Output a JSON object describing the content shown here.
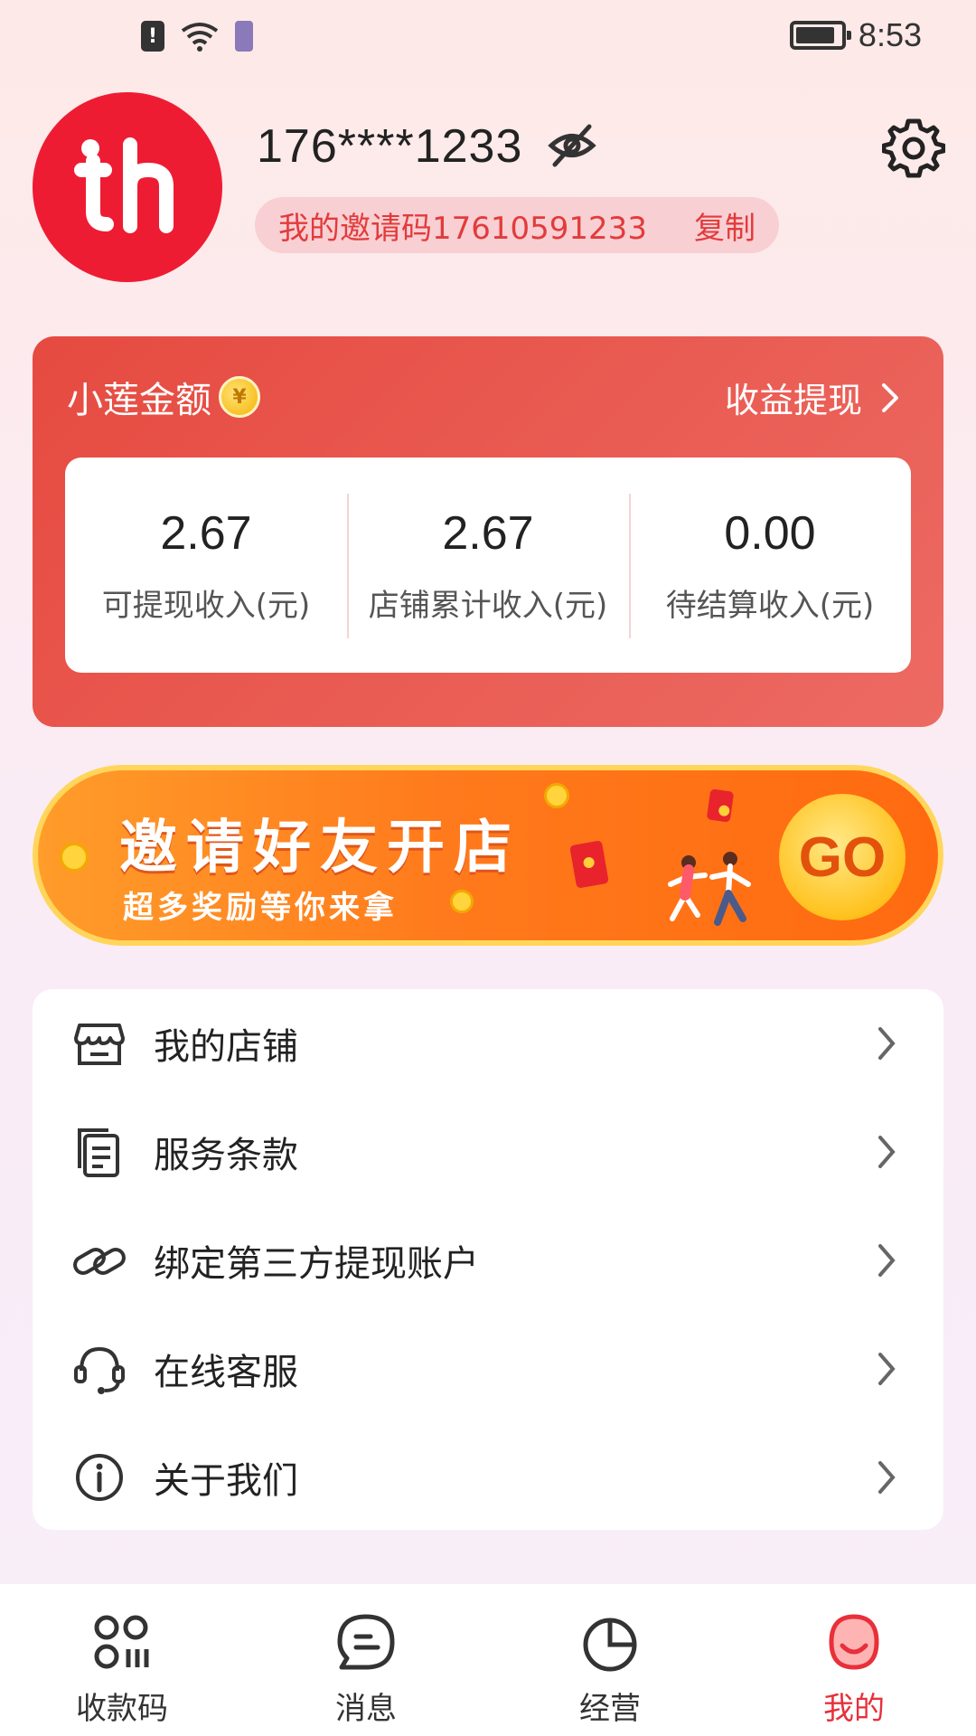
{
  "status_bar": {
    "time": "8:53"
  },
  "profile": {
    "phone": "176****1233",
    "invite_code_text": "我的邀请码17610591233",
    "copy_label": "复制"
  },
  "balance": {
    "title": "小莲金额",
    "withdraw_label": "收益提现",
    "stats": [
      {
        "value": "2.67",
        "label": "可提现收入(元)"
      },
      {
        "value": "2.67",
        "label": "店铺累计收入(元)"
      },
      {
        "value": "0.00",
        "label": "待结算收入(元)"
      }
    ]
  },
  "banner": {
    "title": "邀请好友开店",
    "subtitle": "超多奖励等你来拿",
    "button": "GO"
  },
  "menu": {
    "items": [
      {
        "label": "我的店铺",
        "icon": "store-icon"
      },
      {
        "label": "服务条款",
        "icon": "document-icon"
      },
      {
        "label": "绑定第三方提现账户",
        "icon": "link-icon"
      },
      {
        "label": "在线客服",
        "icon": "headset-icon"
      },
      {
        "label": "关于我们",
        "icon": "info-icon"
      }
    ]
  },
  "tabs": [
    {
      "label": "收款码",
      "icon": "qr-grid-icon",
      "active": false
    },
    {
      "label": "消息",
      "icon": "message-icon",
      "active": false
    },
    {
      "label": "经营",
      "icon": "pie-chart-icon",
      "active": false
    },
    {
      "label": "我的",
      "icon": "profile-icon",
      "active": true
    }
  ],
  "colors": {
    "accent": "#e8303a",
    "card_red": "#e64a40",
    "banner_orange": "#ff7a1c"
  }
}
